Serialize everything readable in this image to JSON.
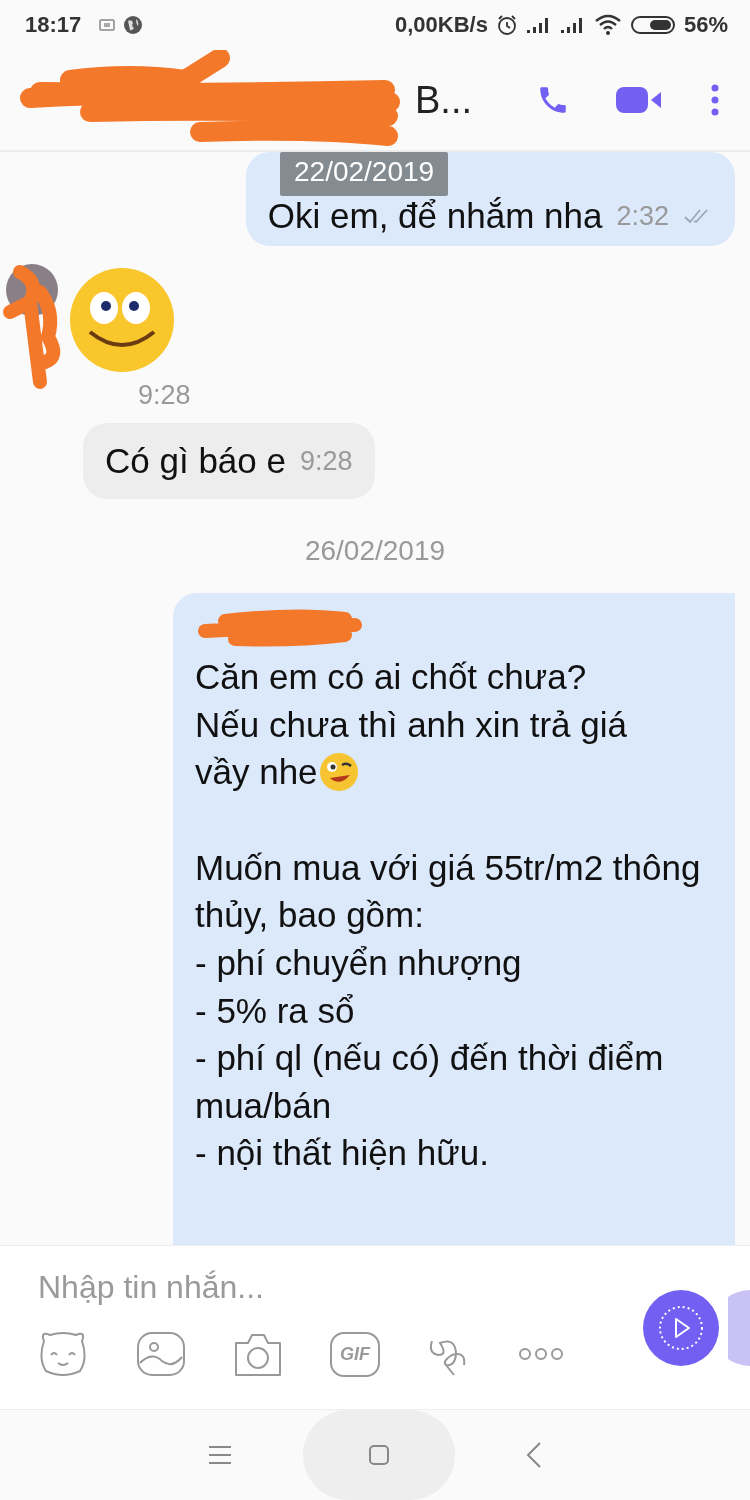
{
  "status_bar": {
    "time": "18:17",
    "speed": "0,00KB/s",
    "battery": "56%"
  },
  "header": {
    "title": "B..."
  },
  "sticky_date": "22/02/2019",
  "messages": [
    {
      "kind": "text",
      "outgoing": true,
      "text": "Oki em, để nhắm nha",
      "time": "2:32",
      "read": true
    },
    {
      "kind": "sticker",
      "time": "9:28"
    },
    {
      "kind": "text",
      "outgoing": false,
      "text": "Có gì báo e",
      "time": "9:28"
    },
    {
      "kind": "date",
      "text": "26/02/2019"
    },
    {
      "kind": "long",
      "outgoing": true,
      "lead": "Căn em có ai chốt chưa?\nNếu chưa thì anh xin trả giá",
      "lead_end": "vầy nhe",
      "body": "Muốn mua với giá 55tr/m2 thông thủy, bao gồm:\n- phí chuyển nhượng\n- 5% ra sổ\n- phí ql (nếu có) đến thời điểm mua/bán\n- nội thất hiện hữu."
    }
  ],
  "composer": {
    "placeholder": "Nhập tin nhắn...",
    "gif_label": "GIF"
  }
}
